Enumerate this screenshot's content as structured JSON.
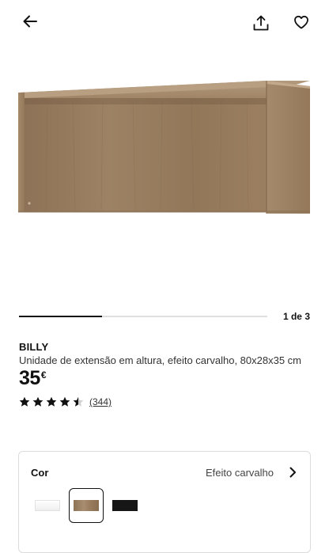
{
  "header": {
    "back_icon": "arrow-left-icon",
    "share_icon": "share-upload-icon",
    "favorite_icon": "heart-outline-icon"
  },
  "gallery": {
    "current": 1,
    "total": 3,
    "counter_text": "1 de 3",
    "progress_fraction": 0.333
  },
  "product": {
    "name": "BILLY",
    "description": "Unidade de extensão em altura, efeito carvalho, 80x28x35 cm",
    "price_integer": "35",
    "price_currency": "€",
    "rating_stars": 4.5,
    "review_count": "(344)"
  },
  "color_picker": {
    "label": "Cor",
    "selected_value": "Efeito carvalho",
    "chevron_icon": "chevron-right-icon",
    "options": [
      {
        "name": "branco",
        "color": "#ffffff",
        "selected": false
      },
      {
        "name": "efeito carvalho",
        "color": "#a08566",
        "selected": true
      },
      {
        "name": "preto",
        "color": "#161616",
        "selected": false
      }
    ]
  },
  "colors": {
    "text": "#111111",
    "wood_face": "#9a7f61",
    "wood_dark": "#7d6349"
  }
}
